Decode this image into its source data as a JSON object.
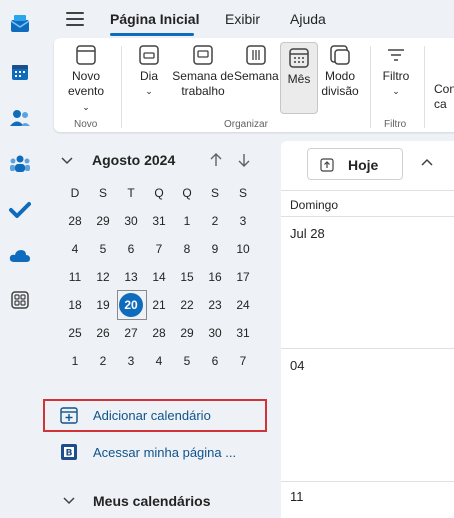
{
  "tabs": [
    {
      "label": "Página Inicial"
    },
    {
      "label": "Exibir"
    },
    {
      "label": "Ajuda"
    }
  ],
  "ribbon": {
    "new_event": {
      "line1": "Novo",
      "line2": "evento"
    },
    "day": {
      "label": "Dia"
    },
    "work_week": {
      "line1": "Semana de",
      "line2": "trabalho"
    },
    "week": {
      "label": "Semana"
    },
    "month": {
      "label": "Mês"
    },
    "split": {
      "line1": "Modo",
      "line2": "divisão"
    },
    "filter": {
      "label": "Filtro"
    },
    "partial": {
      "line1": "Con",
      "line2": "ca"
    },
    "groups": {
      "novo": "Novo",
      "organizar": "Organizar",
      "filtro": "Filtro"
    }
  },
  "mini_calendar": {
    "month_title": "Agosto 2024",
    "weekdays": [
      "D",
      "S",
      "T",
      "Q",
      "Q",
      "S",
      "S"
    ],
    "weeks": [
      [
        "28",
        "29",
        "30",
        "31",
        "1",
        "2",
        "3"
      ],
      [
        "4",
        "5",
        "6",
        "7",
        "8",
        "9",
        "10"
      ],
      [
        "11",
        "12",
        "13",
        "14",
        "15",
        "16",
        "17"
      ],
      [
        "18",
        "19",
        "20",
        "21",
        "22",
        "23",
        "24"
      ],
      [
        "25",
        "26",
        "27",
        "28",
        "29",
        "30",
        "31"
      ],
      [
        "1",
        "2",
        "3",
        "4",
        "5",
        "6",
        "7"
      ]
    ],
    "today": "20"
  },
  "left_links": {
    "add_calendar": "Adicionar calendário",
    "my_page": "Acessar minha página ...",
    "my_calendars": "Meus calendários"
  },
  "calendar_view": {
    "today_button": "Hoje",
    "column_header": "Domingo",
    "cells": [
      "Jul 28",
      "04",
      "11"
    ]
  },
  "colors": {
    "accent": "#0f6cbd",
    "highlight_border": "#d13438",
    "background": "#eef1f5"
  }
}
